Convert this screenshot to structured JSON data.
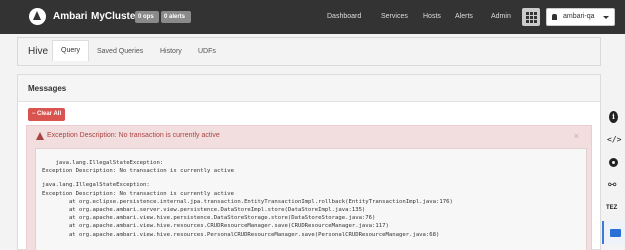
{
  "navbar": {
    "brand": "Ambari",
    "cluster": "MyCluster",
    "ops_badge": "0 ops",
    "alerts_badge": "0 alerts",
    "links": [
      "Dashboard",
      "Services",
      "Hosts",
      "Alerts",
      "Admin"
    ],
    "user": "ambari-qa"
  },
  "subheader": {
    "title": "Hive",
    "tabs": [
      {
        "label": "Query",
        "active": true
      },
      {
        "label": "Saved Queries",
        "active": false
      },
      {
        "label": "History",
        "active": false
      },
      {
        "label": "UDFs",
        "active": false
      }
    ]
  },
  "messages": {
    "heading": "Messages",
    "clear_label": "Clear All",
    "alert_title": "Exception Description: No transaction is currently active",
    "close_symbol": "×",
    "trace_lines": [
      "    java.lang.IllegalStateException:",
      "Exception Description: No transaction is currently active",
      "",
      "java.lang.IllegalStateException:",
      "Exception Description: No transaction is currently active",
      "        at org.eclipse.persistence.internal.jpa.transaction.EntityTransactionImpl.rollback(EntityTransactionImpl.java:176)",
      "        at org.apache.ambari.server.view.persistence.DataStoreImpl.store(DataStoreImpl.java:135)",
      "        at org.apache.ambari.view.hive.persistence.DataStoreStorage.store(DataStoreStorage.java:76)",
      "        at org.apache.ambari.view.hive.resources.CRUDResourceManager.save(CRUDResourceManager.java:117)",
      "        at org.apache.ambari.view.hive.resources.PersonalCRUDResourceManager.save(PersonalCRUDResourceManager.java:68)"
    ]
  },
  "sidebar": {
    "tez_label": "TEZ",
    "icons": [
      "info-icon",
      "code-icon",
      "gear-icon",
      "link-icon",
      "tez-icon",
      "envelope-icon"
    ]
  },
  "colors": {
    "navbar_bg": "#333333",
    "alert_bg": "#f2dede",
    "alert_text": "#a94442",
    "danger_button": "#d9534f",
    "active_accent": "#3b7bd4"
  }
}
